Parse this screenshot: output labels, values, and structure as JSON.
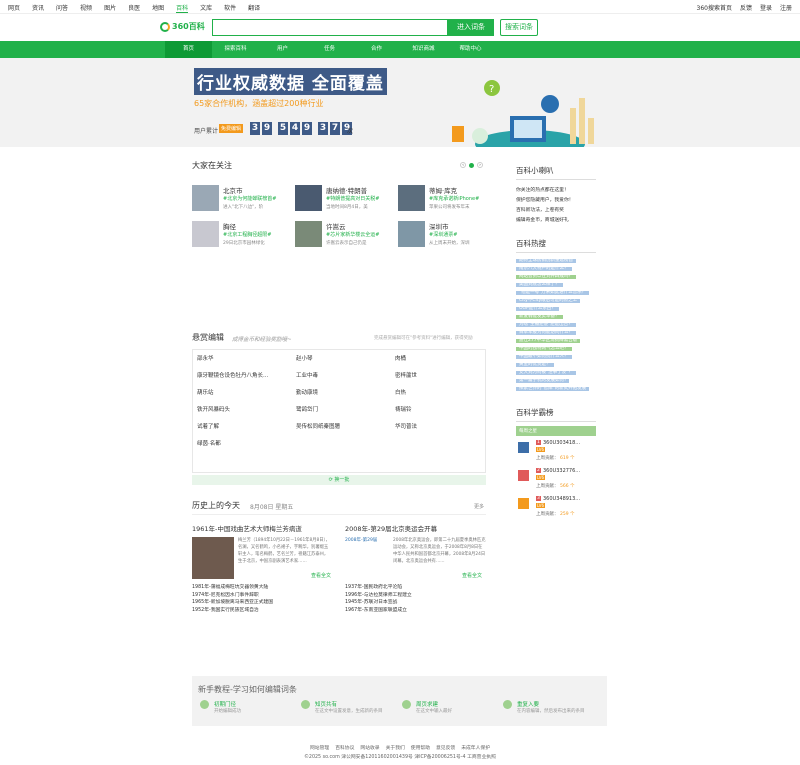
{
  "topnav": {
    "left": [
      "网页",
      "资讯",
      "问答",
      "视频",
      "图片",
      "良医",
      "地图",
      "百科",
      "文库",
      "软件",
      "翻译"
    ],
    "active_index": 7,
    "right": [
      "360搜索首页",
      "反馈",
      "登录",
      "注册"
    ]
  },
  "header": {
    "logo_text": "360百科",
    "search_placeholder": "",
    "enter_btn": "进入词条",
    "search_btn": "搜索词条"
  },
  "mainnav": [
    "首页",
    "探索百科",
    "用户",
    "任务",
    "合作",
    "知识商城",
    "帮助中心"
  ],
  "banner": {
    "headline": "行业权威数据 全面覆盖",
    "sub": "65家合作机构，涵盖超过200种行业",
    "users_label": "用户累计",
    "users_badge": "免费编辑",
    "digits": [
      "3",
      "9",
      "5",
      "4",
      "9",
      "3",
      "7",
      "9"
    ],
    "unit": "次"
  },
  "focus": {
    "title": "大家在关注",
    "cards": [
      {
        "name": "北京市",
        "tag": "#北京为何能蝉联榜首#",
        "desc": "进入\"北下八边\"，阶"
      },
      {
        "name": "唐纳德·特朗普",
        "tag": "#特朗普提高对日关税#",
        "desc": "当地时间8月4日，美"
      },
      {
        "name": "蒂姆·库克",
        "tag": "#库克承诺新iPhone#",
        "desc": "苹果公司将发布年末"
      },
      {
        "name": "胸径",
        "tag": "#北京工程胸径超限#",
        "desc": "29日北京市园林绿化"
      },
      {
        "name": "许嵩云",
        "tag": "#芯片家新华楼云全运#",
        "desc": "许嵩云表示自己仍是"
      },
      {
        "name": "深圳市",
        "tag": "#深圳通票#",
        "desc": "从上周末开始，深圳"
      }
    ]
  },
  "reward": {
    "title": "悬赏编辑",
    "slogan": "成得金币和经验奖励哦~",
    "note": "完成悬赏编辑可在\"参考资料\"进行编辑，获得奖励",
    "items": [
      [
        "邵永华",
        "赵小琴",
        "肉桶"
      ],
      [
        "康牙鞭镜仓设色牡丹八角长...",
        "工业中毒",
        "密梓蘆世"
      ],
      [
        "葫乐站",
        "勤动康境",
        "白热"
      ],
      [
        "铁开风暴码头",
        "鹭鸽岱门",
        "祷瑞铃"
      ],
      [
        "试着了解",
        "吴传松同纸秦图臆",
        "华司普法"
      ],
      [
        "绿茵·名都",
        "",
        ""
      ]
    ],
    "next_label": "换一批"
  },
  "history": {
    "title": "历史上的今天",
    "date": "8月08日 星期五",
    "more": "更多",
    "left": {
      "headline": "1961年-中国戏曲艺术大师梅兰芳病逝",
      "body": "梅兰芳（1894年10月22日－1961年8月8日），名澜，又名鹤鸣，小名裙子，字畹华，别署缀玉轩主人，笔名梅鹤，艺名兰芳，祖籍江苏泰州，生于北京，中国京剧表演艺术家……",
      "view_all": "查看全文",
      "events": [
        "1981年-蒲福成梅旺坑交器领黄大陆",
        "1974年-尼克松因水门事件辞职",
        "1965年-新加坡脱离马来西亚正式建国",
        "1952年-我国实行民族区域自治"
      ]
    },
    "right": {
      "headline": "2008年-第29届北京奥运会开幕",
      "img_alt": "2008年-第29届",
      "body": "2008年北京奥运会，即第二十九届夏季奥林匹克运动会，又称北京奥运会，于2008年8月8日在中华人民共和国首都北京开幕，2008年8月24日闭幕。北京奥运会共有……",
      "view_all": "查看全文",
      "events": [
        "1937年-国民政府北平沦陷",
        "1996年-与达拉莫律师工程建立",
        "1945年-苏联对日本宣战",
        "1967年-东南亚国家联盟成立"
      ]
    }
  },
  "sidebar": {
    "news_title": "百科小喇叭",
    "news": [
      "你关注的热点都在这里！",
      "保护您隐藏用户，我爱你！",
      "百科新功法，上卷有奖",
      "编辑奇金币，商城送好礼"
    ],
    "hot_title": "百科热搜",
    "hot": [
      {
        "t": "期待全球房销创新重返榜首",
        "g": false
      },
      {
        "t": "南京八大特产的是什么？",
        "g": false
      },
      {
        "t": "网站会员以往到开辟成吗？",
        "g": true
      },
      {
        "t": "美国到底怎么样了？",
        "g": false
      },
      {
        "t": "\"他是一号\"万米如此进什么音乐？",
        "g": false
      },
      {
        "t": "City不City眼后可是的原之工",
        "g": false
      },
      {
        "t": "OGP是什么东西？",
        "g": false
      },
      {
        "t": "新爱弱能发卖本备？",
        "g": true
      },
      {
        "t": "为啥\"主播还便\"还是出台？",
        "g": false
      },
      {
        "t": "日本军舰为何能访问什么？",
        "g": false
      },
      {
        "t": "迪仕277中华区消费降需告级",
        "g": true
      },
      {
        "t": "中国的独特网气怎么吧？",
        "g": true
      },
      {
        "t": "中国最不如何找什么人？",
        "g": false
      },
      {
        "t": "黄金的优货是？",
        "g": false
      },
      {
        "t": "艾大到为何被\"注事丁没\"？",
        "g": false
      },
      {
        "t": "第一篇手机的发展如何?",
        "g": false
      },
      {
        "t": "探索世界的\"智库\"的新式开拓发展",
        "g": false
      }
    ],
    "rank_title": "百科学霸榜",
    "rank_tab": "每周之星",
    "rank": [
      {
        "n": "1",
        "name": "360U303418...",
        "lv": "LV6",
        "label": "上周贡献：",
        "score": "619 个"
      },
      {
        "n": "2",
        "name": "360U332776...",
        "lv": "LV6",
        "label": "上周贡献：",
        "score": "566 个"
      },
      {
        "n": "3",
        "name": "360U348913...",
        "lv": "LV6",
        "label": "上周贡献：",
        "score": "259 个"
      }
    ]
  },
  "tutorial": {
    "title": "新手教程-学习如何编辑词条",
    "items": [
      {
        "t": "初期门径",
        "d": "开始编辑成功"
      },
      {
        "t": "知页共有",
        "d": "在这文中设置发意，生成新的条目"
      },
      {
        "t": "周页求建",
        "d": "在这文中输入最好"
      },
      {
        "t": "重复入要",
        "d": "在内容编辑，然后发布出来的条目"
      }
    ]
  },
  "footer": {
    "links": [
      "网站管理",
      "百科协议",
      "网站收录",
      "关于我们",
      "使用帮助",
      "意见反馈",
      "未成年人保护"
    ],
    "copy": "©2025 so.com 津公网安备12011602001439号 津ICP备20006251号-4 工商营业执照"
  }
}
